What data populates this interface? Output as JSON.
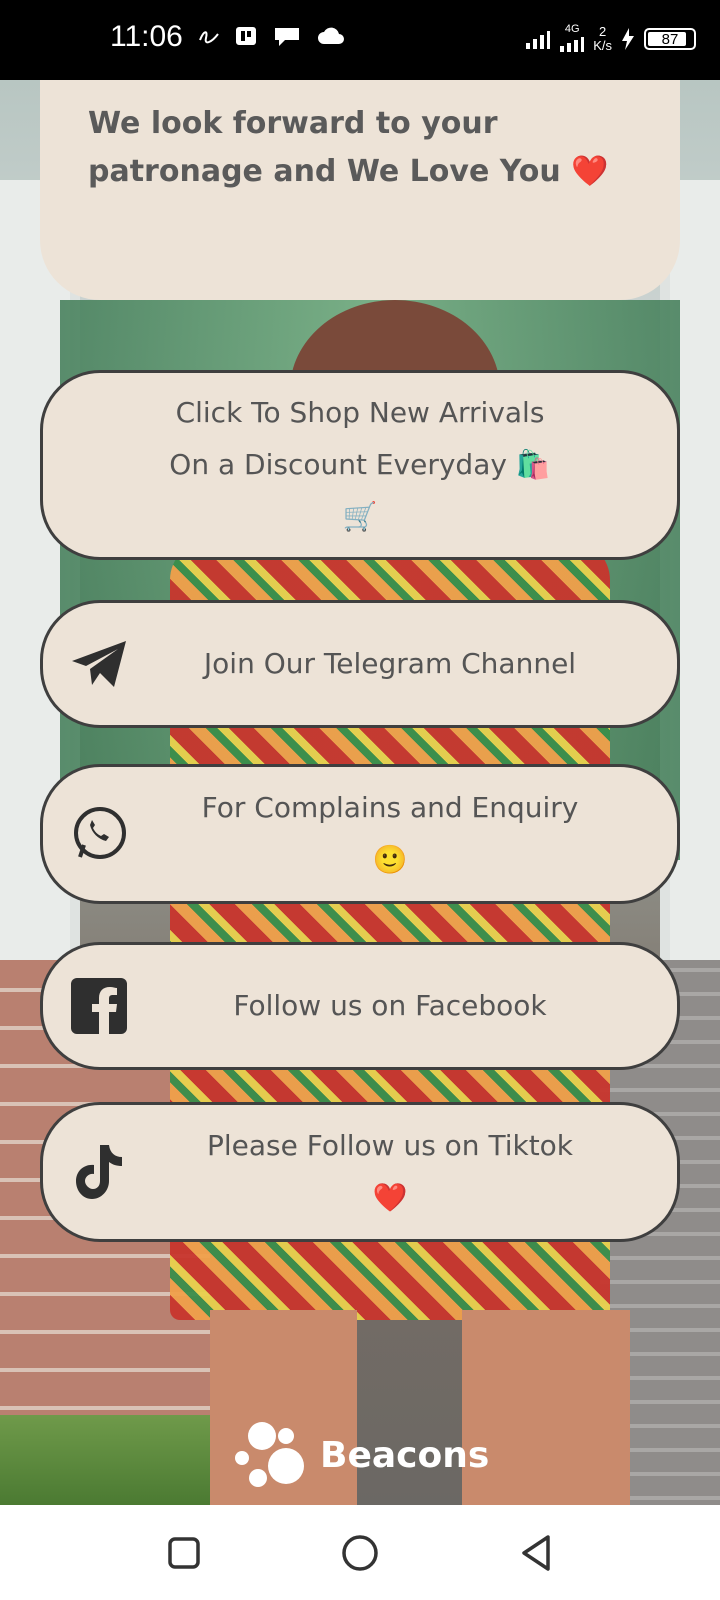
{
  "status_bar": {
    "time": "11:06",
    "network_type": "4G",
    "speed_value": "2",
    "speed_unit": "K/s",
    "battery": "87"
  },
  "intro_card": {
    "text": "We look forward to your patronage and We Love You ❤️"
  },
  "buttons": [
    {
      "icon": "shopping-bag-cart",
      "lines": [
        "Click To Shop New Arrivals",
        "On a Discount Everyday 🛍️",
        "🛒"
      ]
    },
    {
      "icon": "telegram-icon",
      "lines": [
        "Join Our Telegram Channel"
      ]
    },
    {
      "icon": "whatsapp-icon",
      "lines": [
        "For Complains and Enquiry",
        "🙂"
      ]
    },
    {
      "icon": "facebook-icon",
      "lines": [
        "Follow us on Facebook"
      ]
    },
    {
      "icon": "tiktok-icon",
      "lines": [
        "Please Follow us on Tiktok",
        "❤️"
      ]
    }
  ],
  "footer": {
    "brand": "Beacons"
  },
  "colors": {
    "card_bg": "#ede3d7",
    "card_border": "#3f3f3f",
    "text": "#555555"
  }
}
